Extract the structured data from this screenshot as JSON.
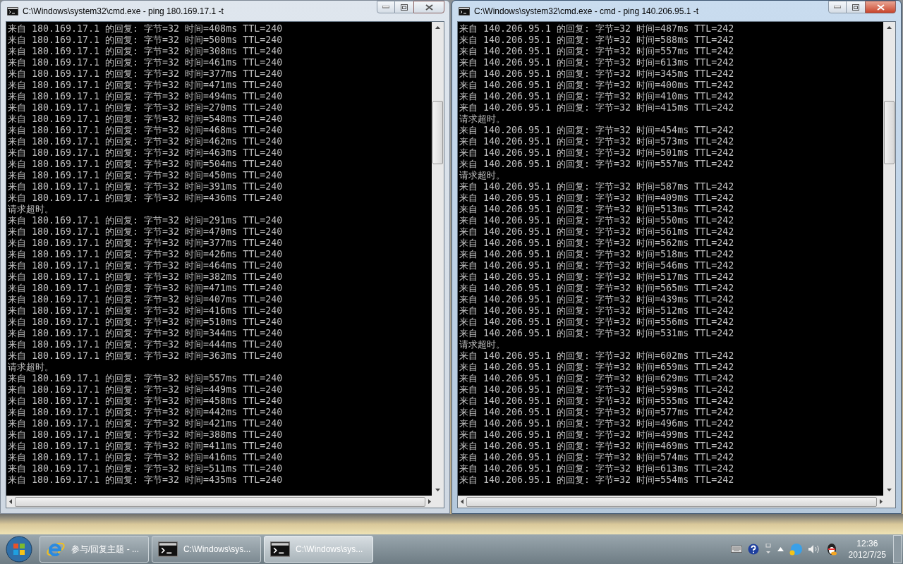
{
  "windows": [
    {
      "title": "C:\\Windows\\system32\\cmd.exe - ping  180.169.17.1 -t",
      "active": false,
      "lines": [
        "来自 180.169.17.1 的回复: 字节=32 时间=408ms TTL=240",
        "来自 180.169.17.1 的回复: 字节=32 时间=500ms TTL=240",
        "来自 180.169.17.1 的回复: 字节=32 时间=308ms TTL=240",
        "来自 180.169.17.1 的回复: 字节=32 时间=461ms TTL=240",
        "来自 180.169.17.1 的回复: 字节=32 时间=377ms TTL=240",
        "来自 180.169.17.1 的回复: 字节=32 时间=471ms TTL=240",
        "来自 180.169.17.1 的回复: 字节=32 时间=494ms TTL=240",
        "来自 180.169.17.1 的回复: 字节=32 时间=270ms TTL=240",
        "来自 180.169.17.1 的回复: 字节=32 时间=548ms TTL=240",
        "来自 180.169.17.1 的回复: 字节=32 时间=468ms TTL=240",
        "来自 180.169.17.1 的回复: 字节=32 时间=462ms TTL=240",
        "来自 180.169.17.1 的回复: 字节=32 时间=463ms TTL=240",
        "来自 180.169.17.1 的回复: 字节=32 时间=504ms TTL=240",
        "来自 180.169.17.1 的回复: 字节=32 时间=450ms TTL=240",
        "来自 180.169.17.1 的回复: 字节=32 时间=391ms TTL=240",
        "来自 180.169.17.1 的回复: 字节=32 时间=436ms TTL=240",
        "请求超时。",
        "来自 180.169.17.1 的回复: 字节=32 时间=291ms TTL=240",
        "来自 180.169.17.1 的回复: 字节=32 时间=470ms TTL=240",
        "来自 180.169.17.1 的回复: 字节=32 时间=377ms TTL=240",
        "来自 180.169.17.1 的回复: 字节=32 时间=426ms TTL=240",
        "来自 180.169.17.1 的回复: 字节=32 时间=464ms TTL=240",
        "来自 180.169.17.1 的回复: 字节=32 时间=382ms TTL=240",
        "来自 180.169.17.1 的回复: 字节=32 时间=471ms TTL=240",
        "来自 180.169.17.1 的回复: 字节=32 时间=407ms TTL=240",
        "来自 180.169.17.1 的回复: 字节=32 时间=416ms TTL=240",
        "来自 180.169.17.1 的回复: 字节=32 时间=510ms TTL=240",
        "来自 180.169.17.1 的回复: 字节=32 时间=344ms TTL=240",
        "来自 180.169.17.1 的回复: 字节=32 时间=444ms TTL=240",
        "来自 180.169.17.1 的回复: 字节=32 时间=363ms TTL=240",
        "请求超时。",
        "来自 180.169.17.1 的回复: 字节=32 时间=557ms TTL=240",
        "来自 180.169.17.1 的回复: 字节=32 时间=449ms TTL=240",
        "来自 180.169.17.1 的回复: 字节=32 时间=458ms TTL=240",
        "来自 180.169.17.1 的回复: 字节=32 时间=442ms TTL=240",
        "来自 180.169.17.1 的回复: 字节=32 时间=421ms TTL=240",
        "来自 180.169.17.1 的回复: 字节=32 时间=388ms TTL=240",
        "来自 180.169.17.1 的回复: 字节=32 时间=411ms TTL=240",
        "来自 180.169.17.1 的回复: 字节=32 时间=416ms TTL=240",
        "来自 180.169.17.1 的回复: 字节=32 时间=511ms TTL=240",
        "来自 180.169.17.1 的回复: 字节=32 时间=435ms TTL=240"
      ]
    },
    {
      "title": "C:\\Windows\\system32\\cmd.exe - cmd - ping  140.206.95.1 -t",
      "active": true,
      "lines": [
        "来自 140.206.95.1 的回复: 字节=32 时间=487ms TTL=242",
        "来自 140.206.95.1 的回复: 字节=32 时间=588ms TTL=242",
        "来自 140.206.95.1 的回复: 字节=32 时间=557ms TTL=242",
        "来自 140.206.95.1 的回复: 字节=32 时间=613ms TTL=242",
        "来自 140.206.95.1 的回复: 字节=32 时间=345ms TTL=242",
        "来自 140.206.95.1 的回复: 字节=32 时间=400ms TTL=242",
        "来自 140.206.95.1 的回复: 字节=32 时间=410ms TTL=242",
        "来自 140.206.95.1 的回复: 字节=32 时间=415ms TTL=242",
        "请求超时。",
        "来自 140.206.95.1 的回复: 字节=32 时间=454ms TTL=242",
        "来自 140.206.95.1 的回复: 字节=32 时间=573ms TTL=242",
        "来自 140.206.95.1 的回复: 字节=32 时间=501ms TTL=242",
        "来自 140.206.95.1 的回复: 字节=32 时间=557ms TTL=242",
        "请求超时。",
        "来自 140.206.95.1 的回复: 字节=32 时间=587ms TTL=242",
        "来自 140.206.95.1 的回复: 字节=32 时间=409ms TTL=242",
        "来自 140.206.95.1 的回复: 字节=32 时间=513ms TTL=242",
        "来自 140.206.95.1 的回复: 字节=32 时间=550ms TTL=242",
        "来自 140.206.95.1 的回复: 字节=32 时间=561ms TTL=242",
        "来自 140.206.95.1 的回复: 字节=32 时间=562ms TTL=242",
        "来自 140.206.95.1 的回复: 字节=32 时间=518ms TTL=242",
        "来自 140.206.95.1 的回复: 字节=32 时间=546ms TTL=242",
        "来自 140.206.95.1 的回复: 字节=32 时间=517ms TTL=242",
        "来自 140.206.95.1 的回复: 字节=32 时间=565ms TTL=242",
        "来自 140.206.95.1 的回复: 字节=32 时间=439ms TTL=242",
        "来自 140.206.95.1 的回复: 字节=32 时间=512ms TTL=242",
        "来自 140.206.95.1 的回复: 字节=32 时间=556ms TTL=242",
        "来自 140.206.95.1 的回复: 字节=32 时间=531ms TTL=242",
        "请求超时。",
        "来自 140.206.95.1 的回复: 字节=32 时间=602ms TTL=242",
        "来自 140.206.95.1 的回复: 字节=32 时间=659ms TTL=242",
        "来自 140.206.95.1 的回复: 字节=32 时间=629ms TTL=242",
        "来自 140.206.95.1 的回复: 字节=32 时间=599ms TTL=242",
        "来自 140.206.95.1 的回复: 字节=32 时间=555ms TTL=242",
        "来自 140.206.95.1 的回复: 字节=32 时间=577ms TTL=242",
        "来自 140.206.95.1 的回复: 字节=32 时间=496ms TTL=242",
        "来自 140.206.95.1 的回复: 字节=32 时间=499ms TTL=242",
        "来自 140.206.95.1 的回复: 字节=32 时间=469ms TTL=242",
        "来自 140.206.95.1 的回复: 字节=32 时间=574ms TTL=242",
        "来自 140.206.95.1 的回复: 字节=32 时间=613ms TTL=242",
        "来自 140.206.95.1 的回复: 字节=32 时间=554ms TTL=242"
      ]
    }
  ],
  "taskbar": {
    "items": [
      {
        "kind": "browser",
        "label": "参与/回复主题 - ...",
        "selected": false
      },
      {
        "kind": "console",
        "label": "C:\\Windows\\sys...",
        "selected": false
      },
      {
        "kind": "console",
        "label": "C:\\Windows\\sys...",
        "selected": true
      }
    ],
    "clock": {
      "time": "12:36",
      "date": "2012/7/25"
    }
  }
}
